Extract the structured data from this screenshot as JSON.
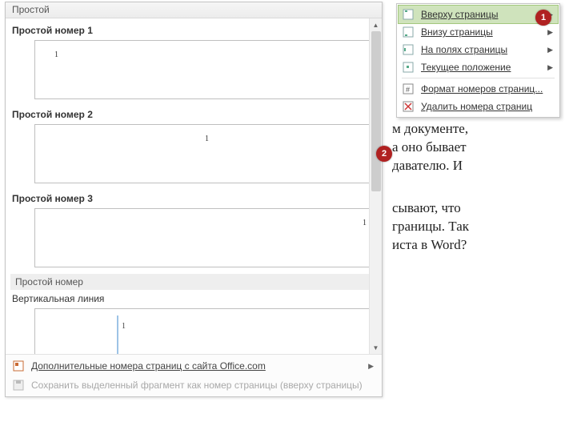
{
  "gallery": {
    "header": "Простой",
    "items": [
      {
        "label": "Простой номер 1",
        "num": "1",
        "align": "left"
      },
      {
        "label": "Простой номер 2",
        "num": "1",
        "align": "center"
      },
      {
        "label": "Простой номер 3",
        "num": "1",
        "align": "right"
      }
    ],
    "section": "Простой номер",
    "vline_label": "Вертикальная линия",
    "vline_num": "1",
    "footer": {
      "more": "Дополнительные номера страниц с сайта Office.com",
      "save": "Сохранить выделенный фрагмент как номер страницы (вверху страницы)"
    }
  },
  "menu": {
    "top": "Вверху страницы",
    "bottom": "Внизу страницы",
    "margins": "На полях страницы",
    "current": "Текущее положение",
    "format": "Формат номеров страниц...",
    "remove": "Удалить номера страниц"
  },
  "doc": {
    "line1": "м документе,",
    "line2": "а оно бывает",
    "line3": "давателю. И",
    "line4": "сывают, что",
    "line5": "границы. Так",
    "line6": "иста в Word?"
  },
  "bullets": {
    "b1": "1",
    "b2": "2"
  },
  "colors": {
    "accent": "#b02121",
    "select": "#cfe3bc"
  }
}
